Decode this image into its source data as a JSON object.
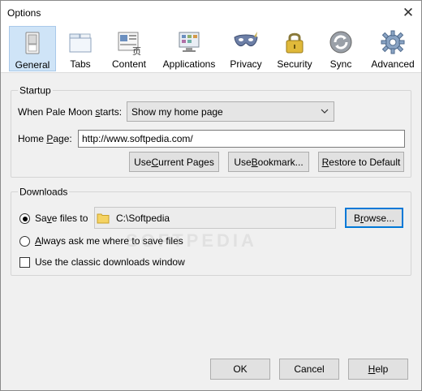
{
  "window": {
    "title": "Options",
    "close_glyph": "✕"
  },
  "toolbar": {
    "items": [
      {
        "label": "General",
        "icon": "general-switch-icon",
        "selected": true
      },
      {
        "label": "Tabs",
        "icon": "tabs-icon"
      },
      {
        "label": "Content",
        "icon": "content-icon"
      },
      {
        "label": "Applications",
        "icon": "applications-icon"
      },
      {
        "label": "Privacy",
        "icon": "privacy-mask-icon"
      },
      {
        "label": "Security",
        "icon": "security-lock-icon"
      },
      {
        "label": "Sync",
        "icon": "sync-icon"
      },
      {
        "label": "Advanced",
        "icon": "advanced-gear-icon"
      }
    ]
  },
  "startup": {
    "legend": "Startup",
    "when_label_pre": "When Pale Moon ",
    "when_label_accel": "s",
    "when_label_post": "tarts:",
    "when_value": "Show my home page",
    "home_label_pre": "Home ",
    "home_label_accel": "P",
    "home_label_post": "age:",
    "home_value": "http://www.softpedia.com/",
    "use_current_pre": "Use ",
    "use_current_accel": "C",
    "use_current_post": "urrent Pages",
    "use_bookmark_pre": "Use ",
    "use_bookmark_accel": "B",
    "use_bookmark_post": "ookmark...",
    "restore_pre": "",
    "restore_accel": "R",
    "restore_post": "estore to Default"
  },
  "downloads": {
    "legend": "Downloads",
    "save_to_pre": "Sa",
    "save_to_accel": "v",
    "save_to_post": "e files to",
    "save_to_checked": true,
    "folder_path": "C:\\Softpedia",
    "browse_pre": "B",
    "browse_accel": "r",
    "browse_post": "owse...",
    "always_ask_pre": "",
    "always_ask_accel": "A",
    "always_ask_post": "lways ask me where to save files",
    "always_ask_checked": false,
    "classic_label": "Use the classic downloads window",
    "classic_checked": false
  },
  "footer": {
    "ok_label": "OK",
    "cancel_label": "Cancel",
    "help_pre": "",
    "help_accel": "H",
    "help_post": "elp"
  },
  "colors": {
    "selected_tab_bg": "#cfe4f7",
    "default_button_border": "#0078d7",
    "folder_yellow": "#f5d363"
  },
  "watermark_text": "SOFTPEDIA"
}
